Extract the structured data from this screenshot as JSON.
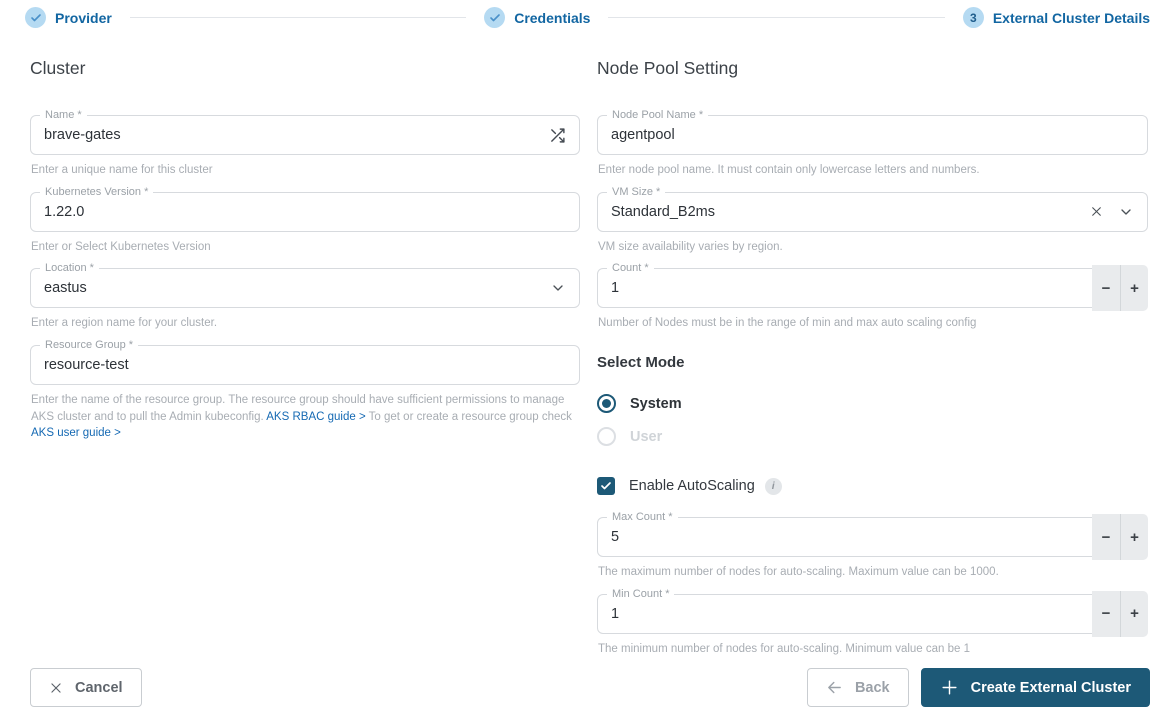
{
  "stepper": {
    "steps": [
      {
        "label": "Provider",
        "status": "complete"
      },
      {
        "label": "Credentials",
        "status": "complete"
      },
      {
        "label": "External Cluster Details",
        "status": "current",
        "number": "3"
      }
    ]
  },
  "cluster": {
    "title": "Cluster",
    "name": {
      "label": "Name *",
      "value": "brave-gates",
      "help": "Enter a unique name for this cluster"
    },
    "kubernetes_version": {
      "label": "Kubernetes Version *",
      "value": "1.22.0",
      "help": "Enter or Select Kubernetes Version"
    },
    "location": {
      "label": "Location *",
      "value": "eastus",
      "help": "Enter a region name for your cluster."
    },
    "resource_group": {
      "label": "Resource Group *",
      "value": "resource-test",
      "help_text_1": "Enter the name of the resource group. The resource group should have sufficient permissions to manage AKS cluster and to pull the Admin kubeconfig. ",
      "link_1": "AKS RBAC guide >",
      "help_text_2": " To get or create a resource group check ",
      "link_2": "AKS user guide >"
    }
  },
  "node_pool": {
    "title": "Node Pool Setting",
    "name": {
      "label": "Node Pool Name *",
      "value": "agentpool",
      "help": "Enter node pool name. It must contain only lowercase letters and numbers."
    },
    "vm_size": {
      "label": "VM Size *",
      "value": "Standard_B2ms",
      "help": "VM size availability varies by region."
    },
    "count": {
      "label": "Count *",
      "value": "1",
      "help": "Number of Nodes must be in the range of min and max auto scaling config"
    },
    "select_mode": {
      "title": "Select Mode",
      "options": [
        {
          "label": "System",
          "selected": true,
          "disabled": false
        },
        {
          "label": "User",
          "selected": false,
          "disabled": true
        }
      ]
    },
    "autoscaling": {
      "label": "Enable AutoScaling",
      "checked": true,
      "info_icon": "i"
    },
    "max_count": {
      "label": "Max Count *",
      "value": "5",
      "help": "The maximum number of nodes for auto-scaling. Maximum value can be 1000."
    },
    "min_count": {
      "label": "Min Count *",
      "value": "1",
      "help": "The minimum number of nodes for auto-scaling. Minimum value can be 1"
    }
  },
  "controls": {
    "minus": "−",
    "plus": "+"
  },
  "footer": {
    "cancel": "Cancel",
    "back": "Back",
    "create": "Create External Cluster"
  },
  "colors": {
    "primary_dark": "#1d5977",
    "step_label_blue": "#1266a2",
    "step_circle_bg": "#b5daf2",
    "link_blue": "#1569b3",
    "helper_gray": "#a8adb3"
  }
}
